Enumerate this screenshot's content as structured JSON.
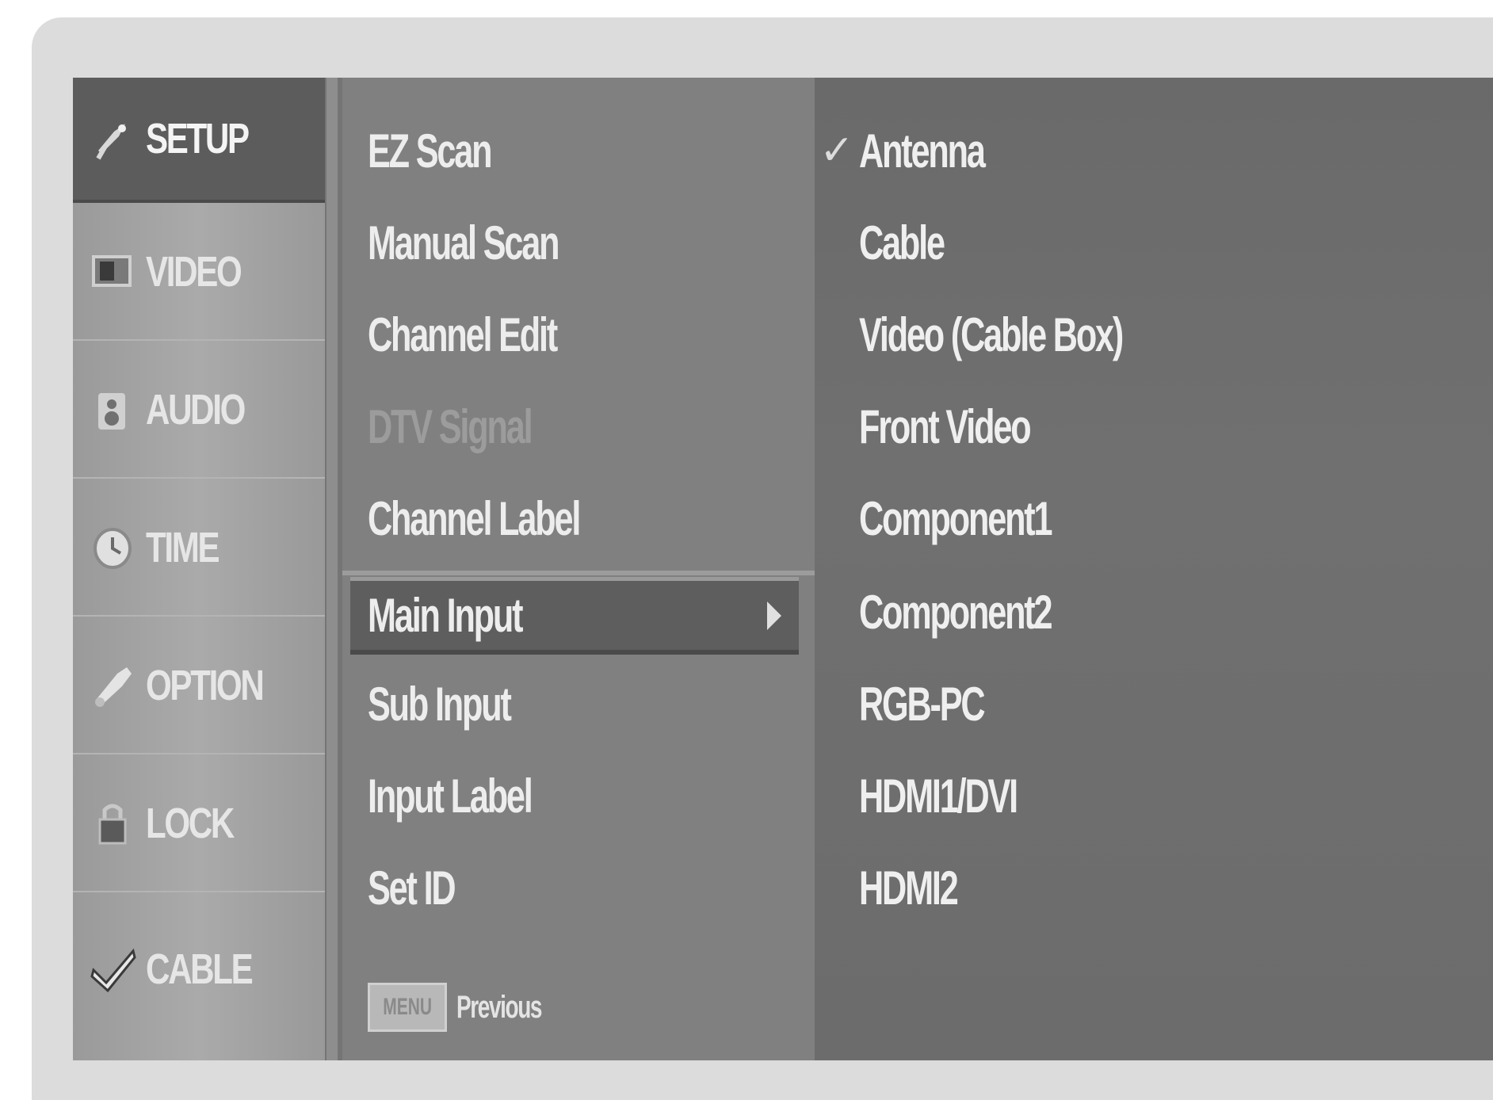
{
  "categories": [
    {
      "label": "SETUP",
      "icon": "satellite-dish-icon",
      "active": true
    },
    {
      "label": "VIDEO",
      "icon": "screen-icon",
      "active": false
    },
    {
      "label": "AUDIO",
      "icon": "speaker-icon",
      "active": false
    },
    {
      "label": "TIME",
      "icon": "clock-icon",
      "active": false
    },
    {
      "label": "OPTION",
      "icon": "wrench-icon",
      "active": false
    },
    {
      "label": "LOCK",
      "icon": "padlock-icon",
      "active": false
    },
    {
      "label": "CABLE",
      "icon": "checkmark-icon",
      "active": false
    }
  ],
  "menu": {
    "items": [
      {
        "label": "EZ Scan",
        "state": "normal"
      },
      {
        "label": "Manual Scan",
        "state": "normal"
      },
      {
        "label": "Channel Edit",
        "state": "normal"
      },
      {
        "label": "DTV Signal",
        "state": "disabled"
      },
      {
        "label": "Channel Label",
        "state": "normal"
      },
      {
        "label": "Main Input",
        "state": "selected"
      },
      {
        "label": "Sub Input",
        "state": "normal"
      },
      {
        "label": "Input Label",
        "state": "normal"
      },
      {
        "label": "Set ID",
        "state": "normal"
      }
    ],
    "footer": {
      "key_label": "MENU",
      "text": "Previous"
    }
  },
  "options": {
    "items": [
      {
        "label": "Antenna",
        "checked": true
      },
      {
        "label": "Cable",
        "checked": false
      },
      {
        "label": "Video (Cable Box)",
        "checked": false
      },
      {
        "label": "Front Video",
        "checked": false
      },
      {
        "label": "Component1",
        "checked": false
      },
      {
        "label": "Component2",
        "checked": false
      },
      {
        "label": "RGB-PC",
        "checked": false
      },
      {
        "label": "HDMI1/DVI",
        "checked": false
      },
      {
        "label": "HDMI2",
        "checked": false
      }
    ],
    "check_mark": "✓"
  },
  "colors": {
    "panel_bg": "#757575",
    "active_category": "#5c5c5c",
    "selected_menu_item": "#5e5e5e",
    "text": "#ededed"
  }
}
